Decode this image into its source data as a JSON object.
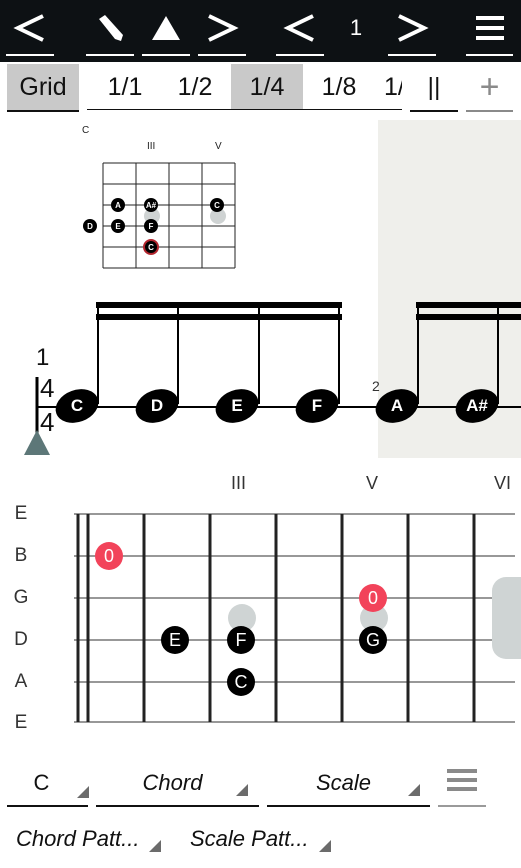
{
  "toolbar": {
    "back_icon": "chevron-left-icon",
    "edit_icon": "pencil-icon",
    "play_icon": "triangle-up-icon",
    "next_icon": "chevron-right-icon",
    "page_prev_icon": "chevron-left-icon",
    "page_number": "1",
    "page_next_icon": "chevron-right-icon",
    "menu_icon": "hamburger-icon"
  },
  "grid_row": {
    "grid_label": "Grid",
    "divisions": [
      "1/1",
      "1/2",
      "1/4",
      "1/8",
      "1/"
    ],
    "selected_division": "1/4",
    "pause_label": "||",
    "add_label": "+"
  },
  "chord_diagram": {
    "title": "C",
    "fret_labels": [
      "III",
      "V"
    ],
    "dots": [
      {
        "note": "A",
        "string": 3,
        "fret": 1
      },
      {
        "note": "A#",
        "string": 3,
        "fret": 2
      },
      {
        "note": "C",
        "string": 3,
        "fret": 4
      },
      {
        "note": "D",
        "string": 4,
        "fret": 0
      },
      {
        "note": "E",
        "string": 4,
        "fret": 1
      },
      {
        "note": "F",
        "string": 4,
        "fret": 2
      },
      {
        "note": "C",
        "string": 5,
        "fret": 2,
        "root": true
      }
    ]
  },
  "score": {
    "measure_1_number": "1",
    "time_signature_top": "4",
    "time_signature_bottom": "4",
    "measure_2_number": "2",
    "notes": [
      "C",
      "D",
      "E",
      "F",
      "A",
      "A#"
    ]
  },
  "fretboard": {
    "strings": [
      "E",
      "B",
      "G",
      "D",
      "A",
      "E"
    ],
    "fret_labels": [
      "III",
      "V",
      "VI"
    ],
    "dots": [
      {
        "label": "0",
        "string": "B",
        "fret": 1,
        "highlight": true
      },
      {
        "label": "E",
        "string": "D",
        "fret": 2
      },
      {
        "label": "F",
        "string": "D",
        "fret": 3
      },
      {
        "label": "C",
        "string": "A",
        "fret": 3
      },
      {
        "label": "0",
        "string": "G",
        "fret": 5,
        "highlight": true
      },
      {
        "label": "G",
        "string": "D",
        "fret": 5
      }
    ],
    "highlight_color": "#f2435a"
  },
  "controls": {
    "key": "C",
    "chord": "Chord",
    "scale": "Scale",
    "menu_icon": "list-icon",
    "chord_pattern": "Chord Patt...",
    "scale_pattern": "Scale Patt..."
  }
}
